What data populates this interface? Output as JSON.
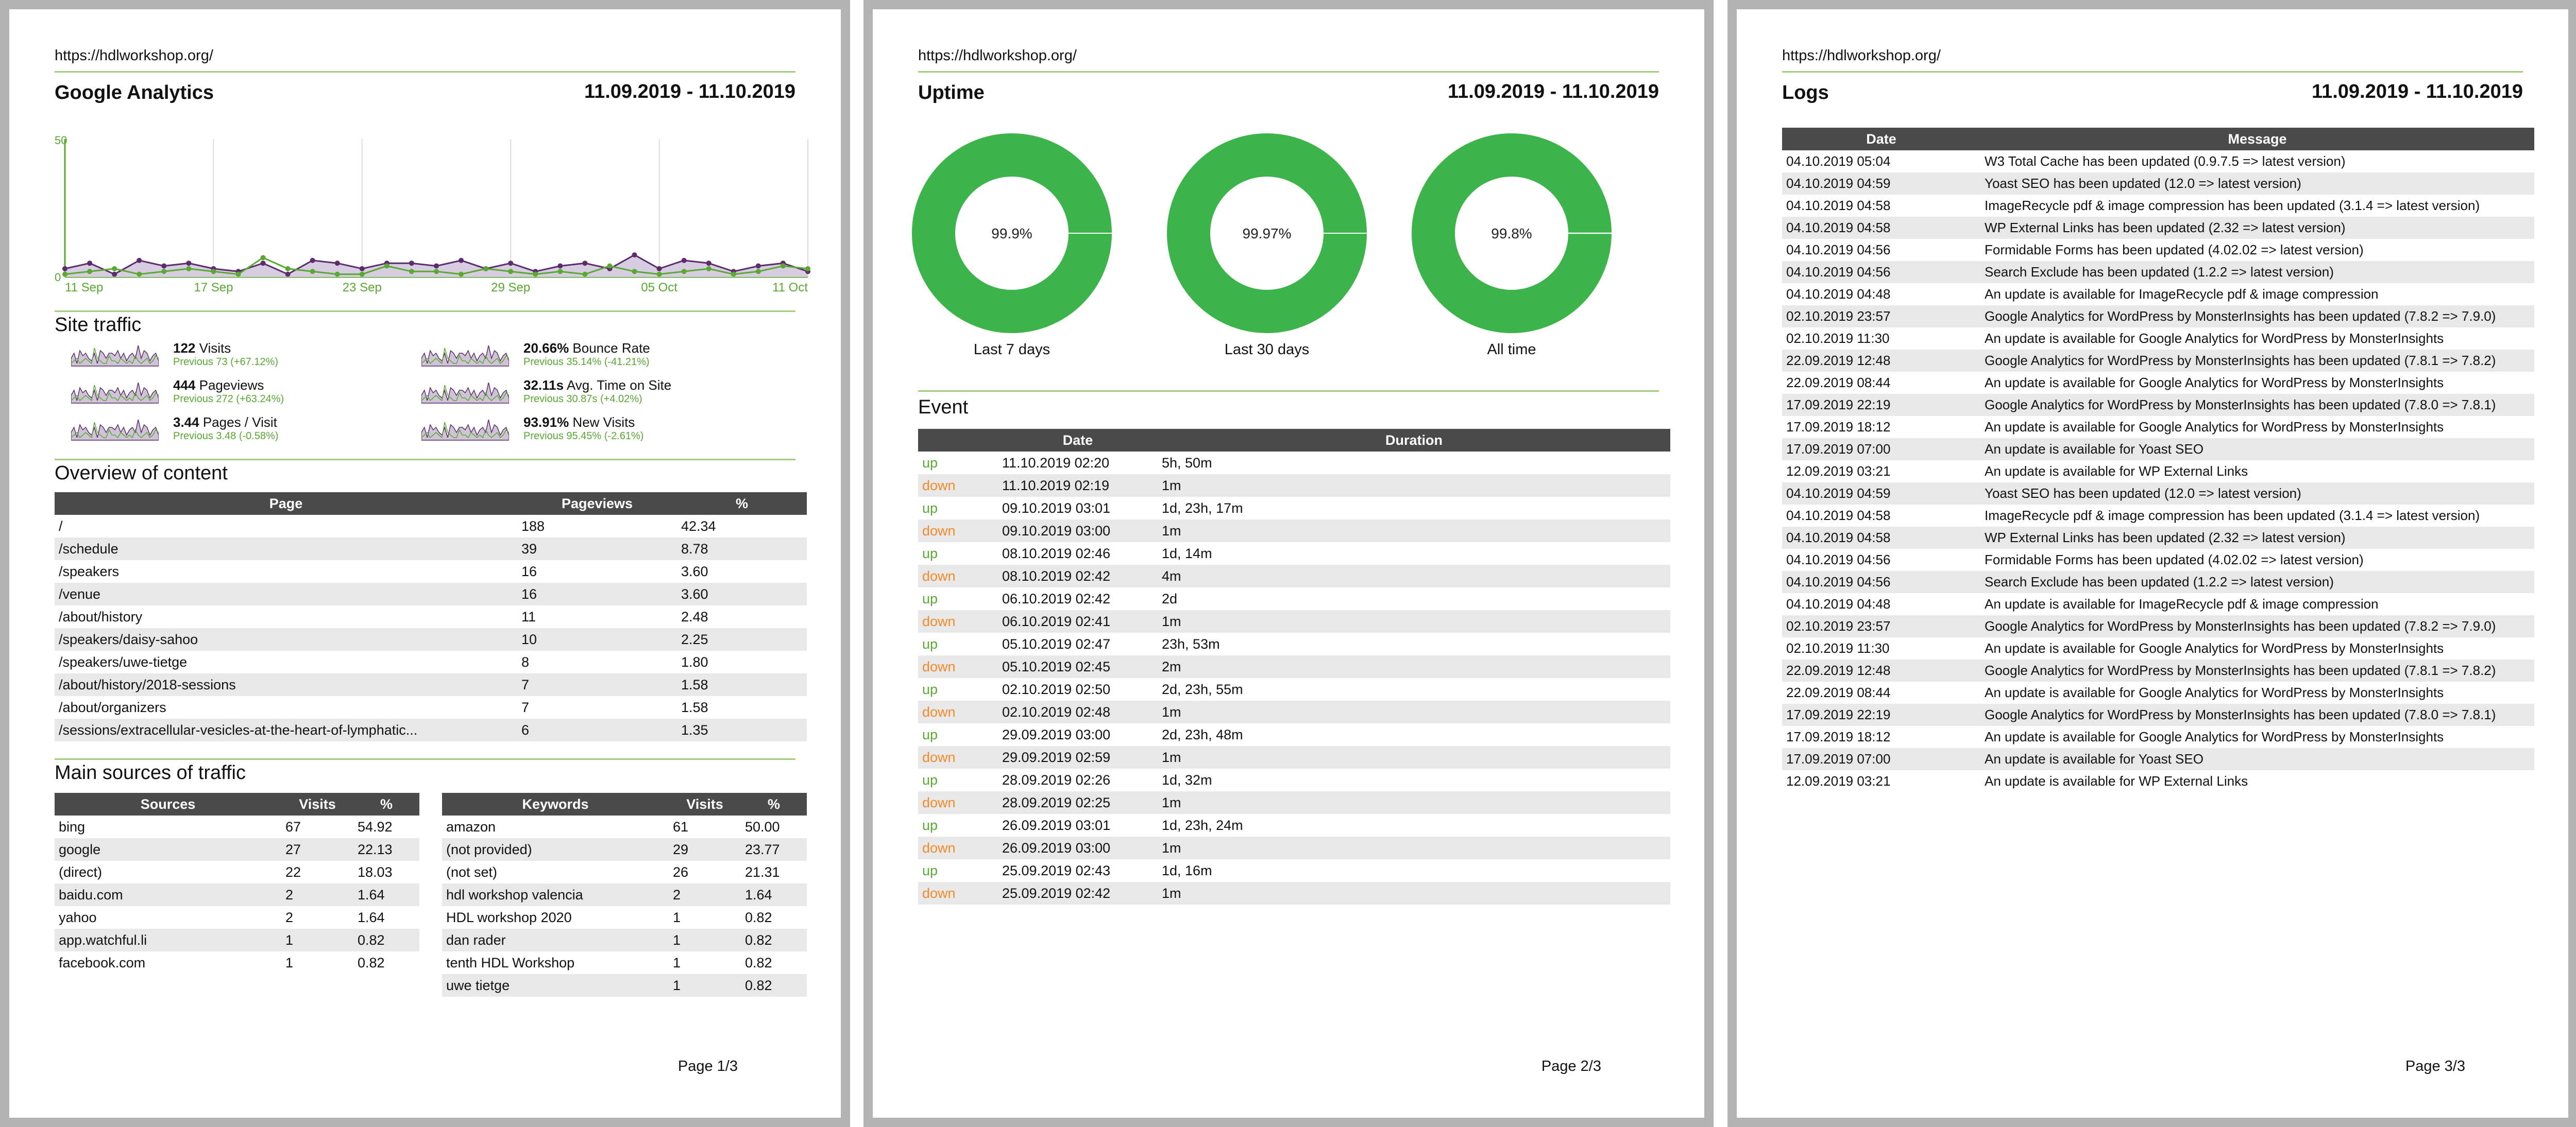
{
  "site_url": "https://hdlworkshop.org/",
  "date_range": "11.09.2019 - 11.10.2019",
  "page1": {
    "title": "Google Analytics",
    "footer": "Page 1/3",
    "chart_data": {
      "type": "line",
      "x_ticks": [
        "11 Sep",
        "17 Sep",
        "23 Sep",
        "29 Sep",
        "05 Oct",
        "11 Oct"
      ],
      "y_ticks": [
        "50",
        "0"
      ],
      "ylim": [
        0,
        50
      ],
      "series": [
        {
          "color": "#5c2c6d",
          "values": [
            3,
            5,
            1,
            6,
            4,
            5,
            3,
            2,
            5,
            1,
            6,
            5,
            3,
            5,
            5,
            4,
            6,
            3,
            5,
            2,
            4,
            5,
            3,
            8,
            3,
            6,
            5,
            2,
            4,
            5,
            2
          ]
        },
        {
          "color": "#59a832",
          "values": [
            1,
            2,
            3,
            1,
            2,
            3,
            2,
            1,
            7,
            3,
            2,
            1,
            1,
            4,
            2,
            2,
            1,
            3,
            2,
            1,
            2,
            1,
            4,
            2,
            1,
            2,
            3,
            1,
            2,
            4,
            3
          ]
        }
      ]
    },
    "site_traffic_title": "Site traffic",
    "stats": [
      {
        "value": "122",
        "label": "Visits",
        "prev": "Previous 73 (+67.12%)"
      },
      {
        "value": "20.66%",
        "label": "Bounce Rate",
        "prev": "Previous 35.14% (-41.21%)"
      },
      {
        "value": "444",
        "label": "Pageviews",
        "prev": "Previous 272 (+63.24%)"
      },
      {
        "value": "32.11s",
        "label": "Avg. Time on Site",
        "prev": "Previous 30.87s (+4.02%)"
      },
      {
        "value": "3.44",
        "label": "Pages / Visit",
        "prev": "Previous 3.48 (-0.58%)"
      },
      {
        "value": "93.91%",
        "label": "New Visits",
        "prev": "Previous 95.45% (-2.61%)"
      }
    ],
    "overview_title": "Overview of content",
    "content_headers": [
      "Page",
      "Pageviews",
      "%"
    ],
    "content_rows": [
      [
        "/",
        "188",
        "42.34"
      ],
      [
        "/schedule",
        "39",
        "8.78"
      ],
      [
        "/speakers",
        "16",
        "3.60"
      ],
      [
        "/venue",
        "16",
        "3.60"
      ],
      [
        "/about/history",
        "11",
        "2.48"
      ],
      [
        "/speakers/daisy-sahoo",
        "10",
        "2.25"
      ],
      [
        "/speakers/uwe-tietge",
        "8",
        "1.80"
      ],
      [
        "/about/history/2018-sessions",
        "7",
        "1.58"
      ],
      [
        "/about/organizers",
        "7",
        "1.58"
      ],
      [
        "/sessions/extracellular-vesicles-at-the-heart-of-lymphatic...",
        "6",
        "1.35"
      ]
    ],
    "sources_title": "Main sources of traffic",
    "sources_headers": [
      "Sources",
      "Visits",
      "%"
    ],
    "sources_rows": [
      [
        "bing",
        "67",
        "54.92"
      ],
      [
        "google",
        "27",
        "22.13"
      ],
      [
        "(direct)",
        "22",
        "18.03"
      ],
      [
        "baidu.com",
        "2",
        "1.64"
      ],
      [
        "yahoo",
        "2",
        "1.64"
      ],
      [
        "app.watchful.li",
        "1",
        "0.82"
      ],
      [
        "facebook.com",
        "1",
        "0.82"
      ]
    ],
    "keywords_headers": [
      "Keywords",
      "Visits",
      "%"
    ],
    "keywords_rows": [
      [
        "amazon",
        "61",
        "50.00"
      ],
      [
        "(not provided)",
        "29",
        "23.77"
      ],
      [
        "(not set)",
        "26",
        "21.31"
      ],
      [
        "hdl workshop valencia",
        "2",
        "1.64"
      ],
      [
        "HDL workshop 2020",
        "1",
        "0.82"
      ],
      [
        "dan rader",
        "1",
        "0.82"
      ],
      [
        "tenth HDL Workshop",
        "1",
        "0.82"
      ],
      [
        "uwe tietge",
        "1",
        "0.82"
      ]
    ]
  },
  "page2": {
    "title": "Uptime",
    "footer": "Page 2/3",
    "uptime": [
      {
        "percent": "99.9%",
        "label": "Last 7 days",
        "value": 99.9
      },
      {
        "percent": "99.97%",
        "label": "Last 30 days",
        "value": 99.97
      },
      {
        "percent": "99.8%",
        "label": "All time",
        "value": 99.8
      }
    ],
    "colors": {
      "up": "#3cb44b",
      "down": "#f28a2a"
    },
    "event_title": "Event",
    "event_headers": [
      "",
      "Date",
      "Duration"
    ],
    "events": [
      [
        "up",
        "11.10.2019 02:20",
        "5h, 50m"
      ],
      [
        "down",
        "11.10.2019 02:19",
        "1m"
      ],
      [
        "up",
        "09.10.2019 03:01",
        "1d, 23h, 17m"
      ],
      [
        "down",
        "09.10.2019 03:00",
        "1m"
      ],
      [
        "up",
        "08.10.2019 02:46",
        "1d, 14m"
      ],
      [
        "down",
        "08.10.2019 02:42",
        "4m"
      ],
      [
        "up",
        "06.10.2019 02:42",
        "2d"
      ],
      [
        "down",
        "06.10.2019 02:41",
        "1m"
      ],
      [
        "up",
        "05.10.2019 02:47",
        "23h, 53m"
      ],
      [
        "down",
        "05.10.2019 02:45",
        "2m"
      ],
      [
        "up",
        "02.10.2019 02:50",
        "2d, 23h, 55m"
      ],
      [
        "down",
        "02.10.2019 02:48",
        "1m"
      ],
      [
        "up",
        "29.09.2019 03:00",
        "2d, 23h, 48m"
      ],
      [
        "down",
        "29.09.2019 02:59",
        "1m"
      ],
      [
        "up",
        "28.09.2019 02:26",
        "1d, 32m"
      ],
      [
        "down",
        "28.09.2019 02:25",
        "1m"
      ],
      [
        "up",
        "26.09.2019 03:01",
        "1d, 23h, 24m"
      ],
      [
        "down",
        "26.09.2019 03:00",
        "1m"
      ],
      [
        "up",
        "25.09.2019 02:43",
        "1d, 16m"
      ],
      [
        "down",
        "25.09.2019 02:42",
        "1m"
      ]
    ]
  },
  "page3": {
    "title": "Logs",
    "footer": "Page 3/3",
    "log_headers": [
      "Date",
      "Message"
    ],
    "logs": [
      [
        "04.10.2019 05:04",
        "W3 Total Cache has been updated (0.9.7.5 => latest version)"
      ],
      [
        "04.10.2019 04:59",
        "Yoast SEO has been updated (12.0 => latest version)"
      ],
      [
        "04.10.2019 04:58",
        "ImageRecycle pdf & image compression has been updated (3.1.4 => latest version)"
      ],
      [
        "04.10.2019 04:58",
        "WP External Links has been updated (2.32 => latest version)"
      ],
      [
        "04.10.2019 04:56",
        "Formidable Forms has been updated (4.02.02 => latest version)"
      ],
      [
        "04.10.2019 04:56",
        "Search Exclude has been updated (1.2.2 => latest version)"
      ],
      [
        "04.10.2019 04:48",
        "An update is available for ImageRecycle pdf & image compression"
      ],
      [
        "02.10.2019 23:57",
        "Google Analytics for WordPress by MonsterInsights has been updated (7.8.2 => 7.9.0)"
      ],
      [
        "02.10.2019 11:30",
        "An update is available for Google Analytics for WordPress by MonsterInsights"
      ],
      [
        "22.09.2019 12:48",
        "Google Analytics for WordPress by MonsterInsights has been updated (7.8.1 => 7.8.2)"
      ],
      [
        "22.09.2019 08:44",
        "An update is available for Google Analytics for WordPress by MonsterInsights"
      ],
      [
        "17.09.2019 22:19",
        "Google Analytics for WordPress by MonsterInsights has been updated (7.8.0 => 7.8.1)"
      ],
      [
        "17.09.2019 18:12",
        "An update is available for Google Analytics for WordPress by MonsterInsights"
      ],
      [
        "17.09.2019 07:00",
        "An update is available for Yoast SEO"
      ],
      [
        "12.09.2019 03:21",
        "An update is available for WP External Links"
      ],
      [
        "04.10.2019 04:59",
        "Yoast SEO has been updated (12.0 => latest version)"
      ],
      [
        "04.10.2019 04:58",
        "ImageRecycle pdf & image compression has been updated (3.1.4 => latest version)"
      ],
      [
        "04.10.2019 04:58",
        "WP External Links has been updated (2.32 => latest version)"
      ],
      [
        "04.10.2019 04:56",
        "Formidable Forms has been updated (4.02.02 => latest version)"
      ],
      [
        "04.10.2019 04:56",
        "Search Exclude has been updated (1.2.2 => latest version)"
      ],
      [
        "04.10.2019 04:48",
        "An update is available for ImageRecycle pdf & image compression"
      ],
      [
        "02.10.2019 23:57",
        "Google Analytics for WordPress by MonsterInsights has been updated (7.8.2 => 7.9.0)"
      ],
      [
        "02.10.2019 11:30",
        "An update is available for Google Analytics for WordPress by MonsterInsights"
      ],
      [
        "22.09.2019 12:48",
        "Google Analytics for WordPress by MonsterInsights has been updated (7.8.1 => 7.8.2)"
      ],
      [
        "22.09.2019 08:44",
        "An update is available for Google Analytics for WordPress by MonsterInsights"
      ],
      [
        "17.09.2019 22:19",
        "Google Analytics for WordPress by MonsterInsights has been updated (7.8.0 => 7.8.1)"
      ],
      [
        "17.09.2019 18:12",
        "An update is available for Google Analytics for WordPress by MonsterInsights"
      ],
      [
        "17.09.2019 07:00",
        "An update is available for Yoast SEO"
      ],
      [
        "12.09.2019 03:21",
        "An update is available for WP External Links"
      ]
    ]
  }
}
